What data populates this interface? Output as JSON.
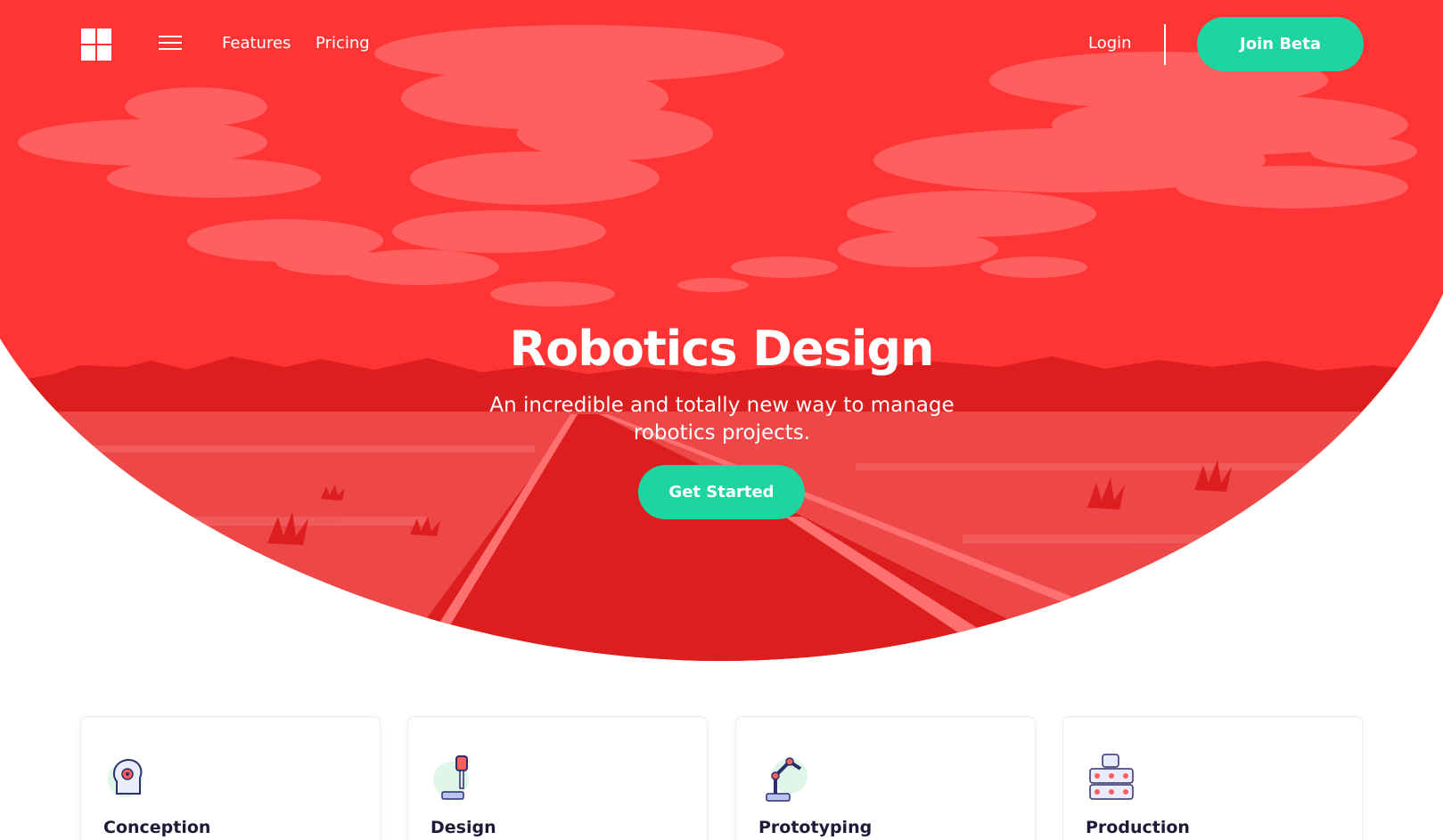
{
  "nav": {
    "logo_icon": "four-squares-logo-icon",
    "menu_icon": "hamburger-menu-icon",
    "links": [
      "Features",
      "Pricing"
    ],
    "login_label": "Login",
    "join_label": "Join Beta"
  },
  "hero": {
    "title": "Robotics Design",
    "subtitle": "An incredible and totally new way to manage robotics projects.",
    "cta_label": "Get Started",
    "background_color": "#ff3434",
    "accent_color": "#1ed4a0"
  },
  "cards": [
    {
      "title": "Conception",
      "icon": "head-brain-icon"
    },
    {
      "title": "Design",
      "icon": "robot-pen-icon"
    },
    {
      "title": "Prototyping",
      "icon": "robot-arm-icon"
    },
    {
      "title": "Production",
      "icon": "robot-stack-icon"
    }
  ]
}
